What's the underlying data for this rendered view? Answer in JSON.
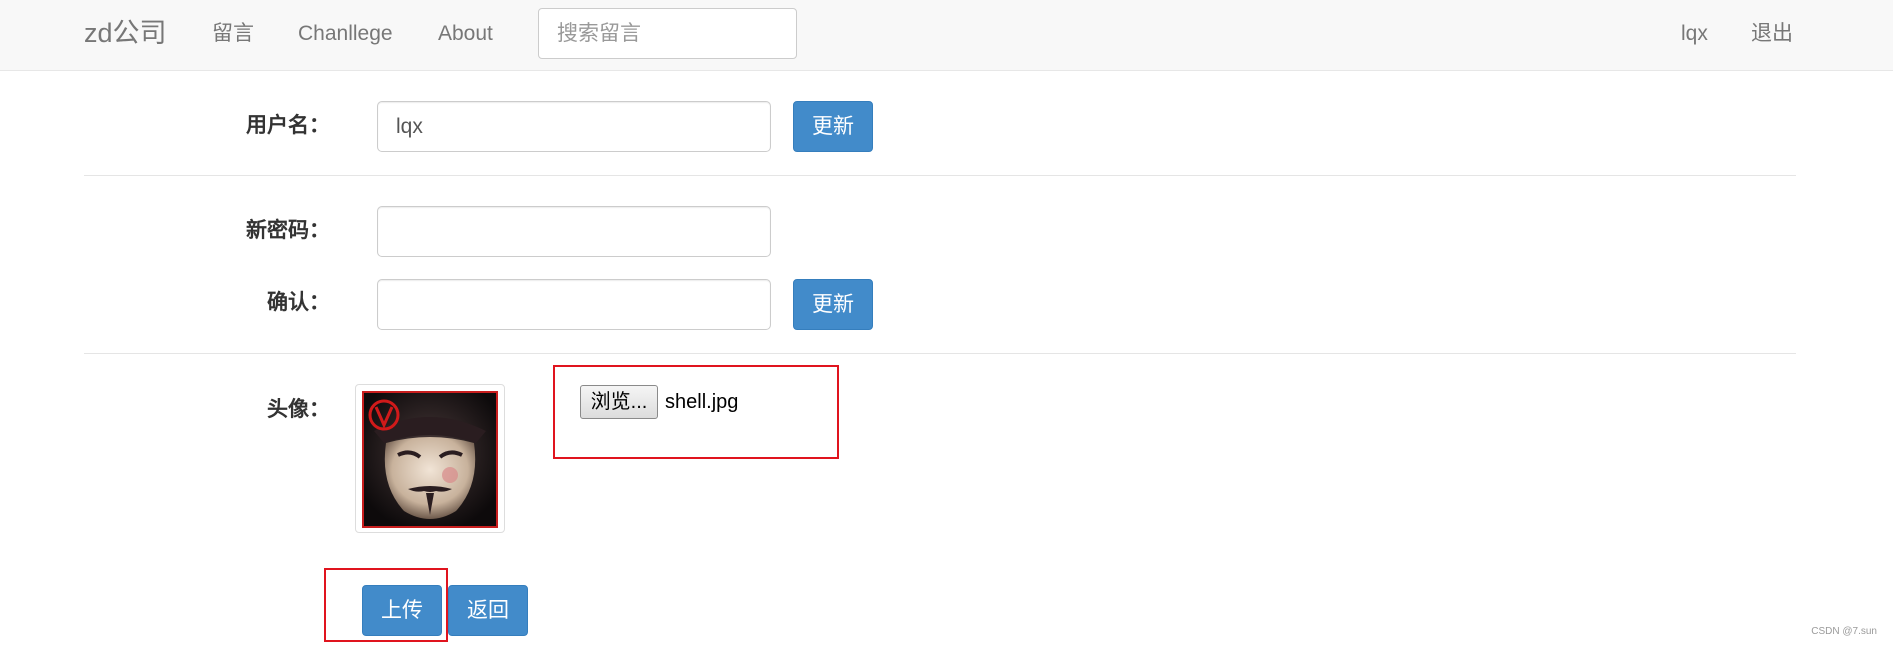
{
  "navbar": {
    "brand": "zd公司",
    "links": [
      "留言",
      "Chanllege",
      "About"
    ],
    "search_placeholder": "搜索留言",
    "user": "lqx",
    "logout": "退出"
  },
  "form": {
    "username": {
      "label": "用户名：",
      "value": "lqx",
      "button": "更新"
    },
    "password": {
      "new_label": "新密码：",
      "new_value": "",
      "confirm_label": "确认：",
      "confirm_value": "",
      "button": "更新"
    },
    "avatar": {
      "label": "头像：",
      "browse_label": "浏览...",
      "file_name": "shell.jpg"
    },
    "actions": {
      "upload": "上传",
      "back": "返回"
    }
  },
  "watermark": "CSDN @7.sun",
  "colors": {
    "primary": "#428bca",
    "highlight": "#e0141e",
    "navbar_bg": "#f8f8f8"
  }
}
